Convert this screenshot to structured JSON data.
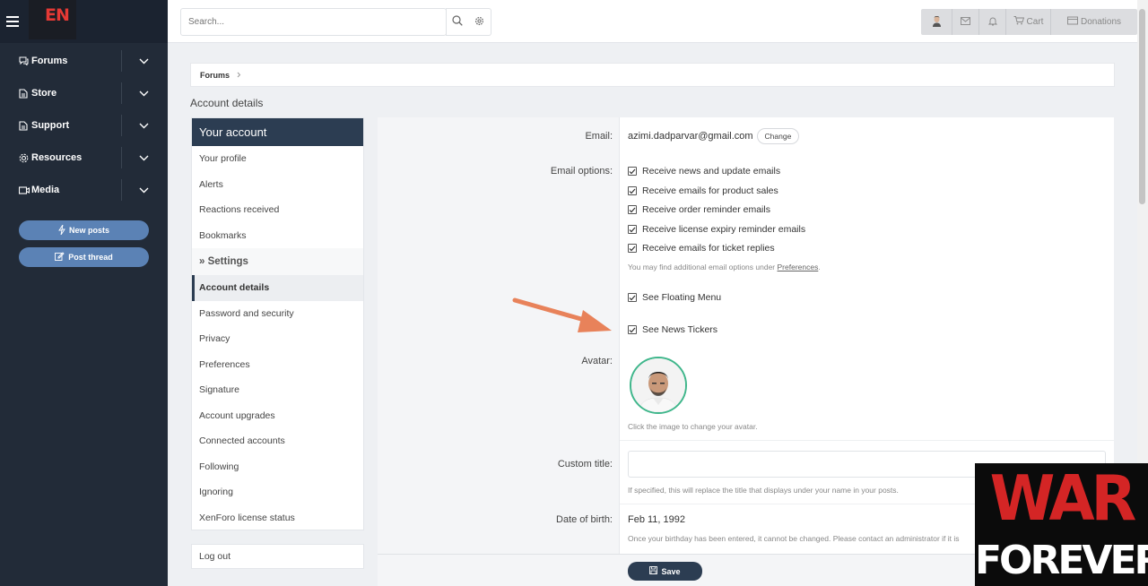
{
  "logo": "EN",
  "nav": [
    {
      "label": "Forums",
      "icon": "comments-icon"
    },
    {
      "label": "Store",
      "icon": "store-icon"
    },
    {
      "label": "Support",
      "icon": "support-icon"
    },
    {
      "label": "Resources",
      "icon": "resources-icon"
    },
    {
      "label": "Media",
      "icon": "media-icon"
    }
  ],
  "side_buttons": {
    "new_posts": "New posts",
    "post_thread": "Post thread"
  },
  "search": {
    "placeholder": "Search..."
  },
  "user_bar": {
    "cart": "Cart",
    "donations": "Donations"
  },
  "breadcrumb": {
    "item": "Forums"
  },
  "page_title": "Account details",
  "account_menu": {
    "header": "Your account",
    "links_top": [
      "Your profile",
      "Alerts",
      "Reactions received",
      "Bookmarks"
    ],
    "settings_label": "» Settings",
    "active": "Account details",
    "links_bottom": [
      "Password and security",
      "Privacy",
      "Preferences",
      "Signature",
      "Account upgrades",
      "Connected accounts",
      "Following",
      "Ignoring",
      "XenForo license status"
    ],
    "logout": "Log out"
  },
  "form": {
    "email_label": "Email:",
    "email_value": "azimi.dadparvar@gmail.com",
    "change_label": "Change",
    "email_options_label": "Email options:",
    "email_options": [
      "Receive news and update emails",
      "Receive emails for product sales",
      "Receive order reminder emails",
      "Receive license expiry reminder emails",
      "Receive emails for ticket replies"
    ],
    "email_hint_prefix": "You may find additional email options under ",
    "email_hint_link": "Preferences",
    "email_hint_suffix": ".",
    "floating_menu": "See Floating Menu",
    "news_tickers": "See News Tickers",
    "avatar_label": "Avatar:",
    "avatar_hint": "Click the image to change your avatar.",
    "custom_title_label": "Custom title:",
    "custom_title_value": "",
    "custom_title_hint": "If specified, this will replace the title that displays under your name in your posts.",
    "dob_label": "Date of birth:",
    "dob_value": "Feb 11, 1992",
    "dob_hint": "Once your birthday has been entered, it cannot be changed. Please contact an administrator if it is",
    "save": "Save"
  },
  "overlay": {
    "line1": "WAR",
    "line2": "FOREVER"
  },
  "colors": {
    "sidebar": "#222b38",
    "accent": "#2c3d52",
    "button": "#5b82b5",
    "arrow": "#e8825a",
    "overlay_red": "#d42525"
  }
}
